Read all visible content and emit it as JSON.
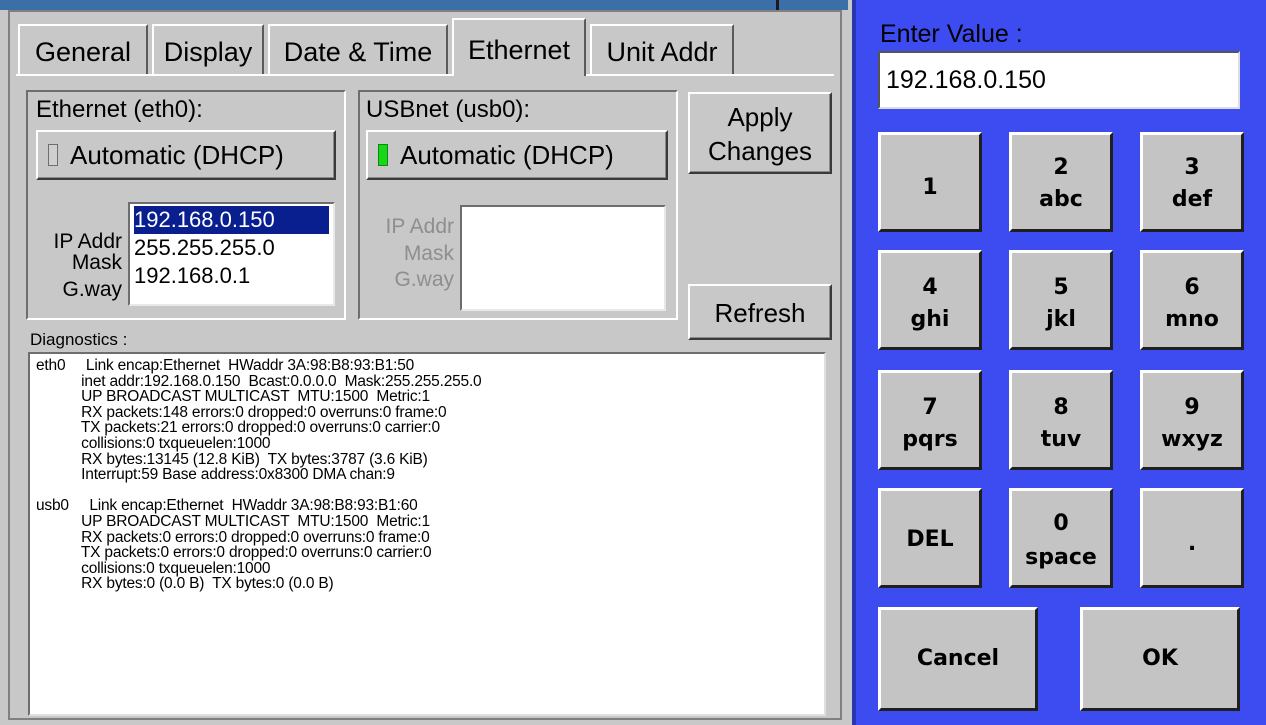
{
  "tabs": [
    {
      "label": "General",
      "active": false
    },
    {
      "label": "Display",
      "active": false
    },
    {
      "label": "Date & Time",
      "active": false
    },
    {
      "label": "Ethernet",
      "active": true
    },
    {
      "label": "Unit Addr",
      "active": false
    }
  ],
  "eth0": {
    "title": "Ethernet (eth0):",
    "dhcp_label": "Automatic (DHCP)",
    "dhcp_enabled": false,
    "labels": [
      "IP Addr",
      "Mask",
      "G.way"
    ],
    "values": [
      "192.168.0.150",
      "255.255.255.0",
      "192.168.0.1"
    ],
    "selected_index": 0
  },
  "usb0": {
    "title": "USBnet (usb0):",
    "dhcp_label": "Automatic (DHCP)",
    "dhcp_enabled": true,
    "labels": [
      "IP Addr",
      "Mask",
      "G.way"
    ],
    "values": []
  },
  "buttons": {
    "apply_line1": "Apply",
    "apply_line2": "Changes",
    "refresh": "Refresh"
  },
  "diagnostics": {
    "label": "Diagnostics :",
    "text": "eth0     Link encap:Ethernet  HWaddr 3A:98:B8:93:B1:50\n           inet addr:192.168.0.150  Bcast:0.0.0.0  Mask:255.255.255.0\n           UP BROADCAST MULTICAST  MTU:1500  Metric:1\n           RX packets:148 errors:0 dropped:0 overruns:0 frame:0\n           TX packets:21 errors:0 dropped:0 overruns:0 carrier:0\n           collisions:0 txqueuelen:1000\n           RX bytes:13145 (12.8 KiB)  TX bytes:3787 (3.6 KiB)\n           Interrupt:59 Base address:0x8300 DMA chan:9\n\nusb0     Link encap:Ethernet  HWaddr 3A:98:B8:93:B1:60\n           UP BROADCAST MULTICAST  MTU:1500  Metric:1\n           RX packets:0 errors:0 dropped:0 overruns:0 frame:0\n           TX packets:0 errors:0 dropped:0 overruns:0 carrier:0\n           collisions:0 txqueuelen:1000\n           RX bytes:0 (0.0 B)  TX bytes:0 (0.0 B)"
  },
  "keypad": {
    "prompt": "Enter Value :",
    "value": "192.168.0.150",
    "keys": [
      {
        "main": "1",
        "sub": ""
      },
      {
        "main": "2",
        "sub": "abc"
      },
      {
        "main": "3",
        "sub": "def"
      },
      {
        "main": "4",
        "sub": "ghi"
      },
      {
        "main": "5",
        "sub": "jkl"
      },
      {
        "main": "6",
        "sub": "mno"
      },
      {
        "main": "7",
        "sub": "pqrs"
      },
      {
        "main": "8",
        "sub": "tuv"
      },
      {
        "main": "9",
        "sub": "wxyz"
      },
      {
        "main": "DEL",
        "sub": ""
      },
      {
        "main": "0",
        "sub": "space"
      },
      {
        "main": ".",
        "sub": ""
      }
    ],
    "cancel": "Cancel",
    "ok": "OK"
  },
  "colors": {
    "keypad_bg": "#3c4cf0",
    "selection": "#0a1f8f",
    "led_on": "#18d618",
    "panel_bg": "#c8c8c8"
  }
}
